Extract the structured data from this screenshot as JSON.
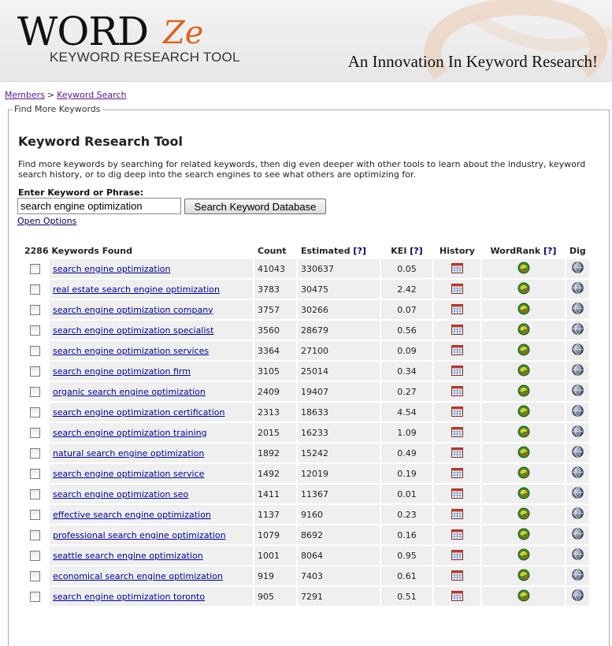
{
  "header": {
    "logo_word": "WORD",
    "logo_ze": "Ze",
    "logo_sub": "KEYWORD RESEARCH TOOL",
    "tagline": "An Innovation In Keyword Research!",
    "accent_color": "#d9641f"
  },
  "breadcrumb": {
    "members": "Members",
    "separator": ">",
    "current": "Keyword Search"
  },
  "panel": {
    "legend": "Find More Keywords"
  },
  "tool": {
    "title": "Keyword Research Tool",
    "intro": "Find more keywords by searching for related keywords, then dig even deeper with other tools to learn about the industry, keyword search history, or to dig deep into the search engines to see what others are optimizing for.",
    "input_label": "Enter Keyword or Phrase:",
    "input_value": "search engine optimization",
    "search_button": "Search Keyword Database",
    "open_options": "Open Options"
  },
  "table": {
    "found_text": "2286 Keywords Found",
    "headers": {
      "count": "Count",
      "estimated": "Estimated",
      "kei": "KEI",
      "history": "History",
      "wordrank": "WordRank",
      "dig": "Dig",
      "help": "[?]"
    },
    "icons": {
      "history": "calendar-icon",
      "wordrank": "wordrank-globe-icon",
      "dig": "dig-globe-icon"
    },
    "rows": [
      {
        "keyword": "search engine optimization",
        "count": "41043",
        "estimated": "330637",
        "kei": "0.05"
      },
      {
        "keyword": "real estate search engine optimization",
        "count": "3783",
        "estimated": "30475",
        "kei": "2.42"
      },
      {
        "keyword": "search engine optimization company",
        "count": "3757",
        "estimated": "30266",
        "kei": "0.07"
      },
      {
        "keyword": "search engine optimization specialist",
        "count": "3560",
        "estimated": "28679",
        "kei": "0.56"
      },
      {
        "keyword": "search engine optimization services",
        "count": "3364",
        "estimated": "27100",
        "kei": "0.09"
      },
      {
        "keyword": "search engine optimization firm",
        "count": "3105",
        "estimated": "25014",
        "kei": "0.34"
      },
      {
        "keyword": "organic search engine optimization",
        "count": "2409",
        "estimated": "19407",
        "kei": "0.27"
      },
      {
        "keyword": "search engine optimization certification",
        "count": "2313",
        "estimated": "18633",
        "kei": "4.54"
      },
      {
        "keyword": "search engine optimization training",
        "count": "2015",
        "estimated": "16233",
        "kei": "1.09"
      },
      {
        "keyword": "natural search engine optimization",
        "count": "1892",
        "estimated": "15242",
        "kei": "0.49"
      },
      {
        "keyword": "search engine optimization service",
        "count": "1492",
        "estimated": "12019",
        "kei": "0.19"
      },
      {
        "keyword": "search engine optimization seo",
        "count": "1411",
        "estimated": "11367",
        "kei": "0.01"
      },
      {
        "keyword": "effective search engine optimization",
        "count": "1137",
        "estimated": "9160",
        "kei": "0.23"
      },
      {
        "keyword": "professional search engine optimization",
        "count": "1079",
        "estimated": "8692",
        "kei": "0.16"
      },
      {
        "keyword": "seattle search engine optimization",
        "count": "1001",
        "estimated": "8064",
        "kei": "0.95"
      },
      {
        "keyword": "economical search engine optimization",
        "count": "919",
        "estimated": "7403",
        "kei": "0.61"
      },
      {
        "keyword": "search engine optimization toronto",
        "count": "905",
        "estimated": "7291",
        "kei": "0.51"
      }
    ]
  }
}
